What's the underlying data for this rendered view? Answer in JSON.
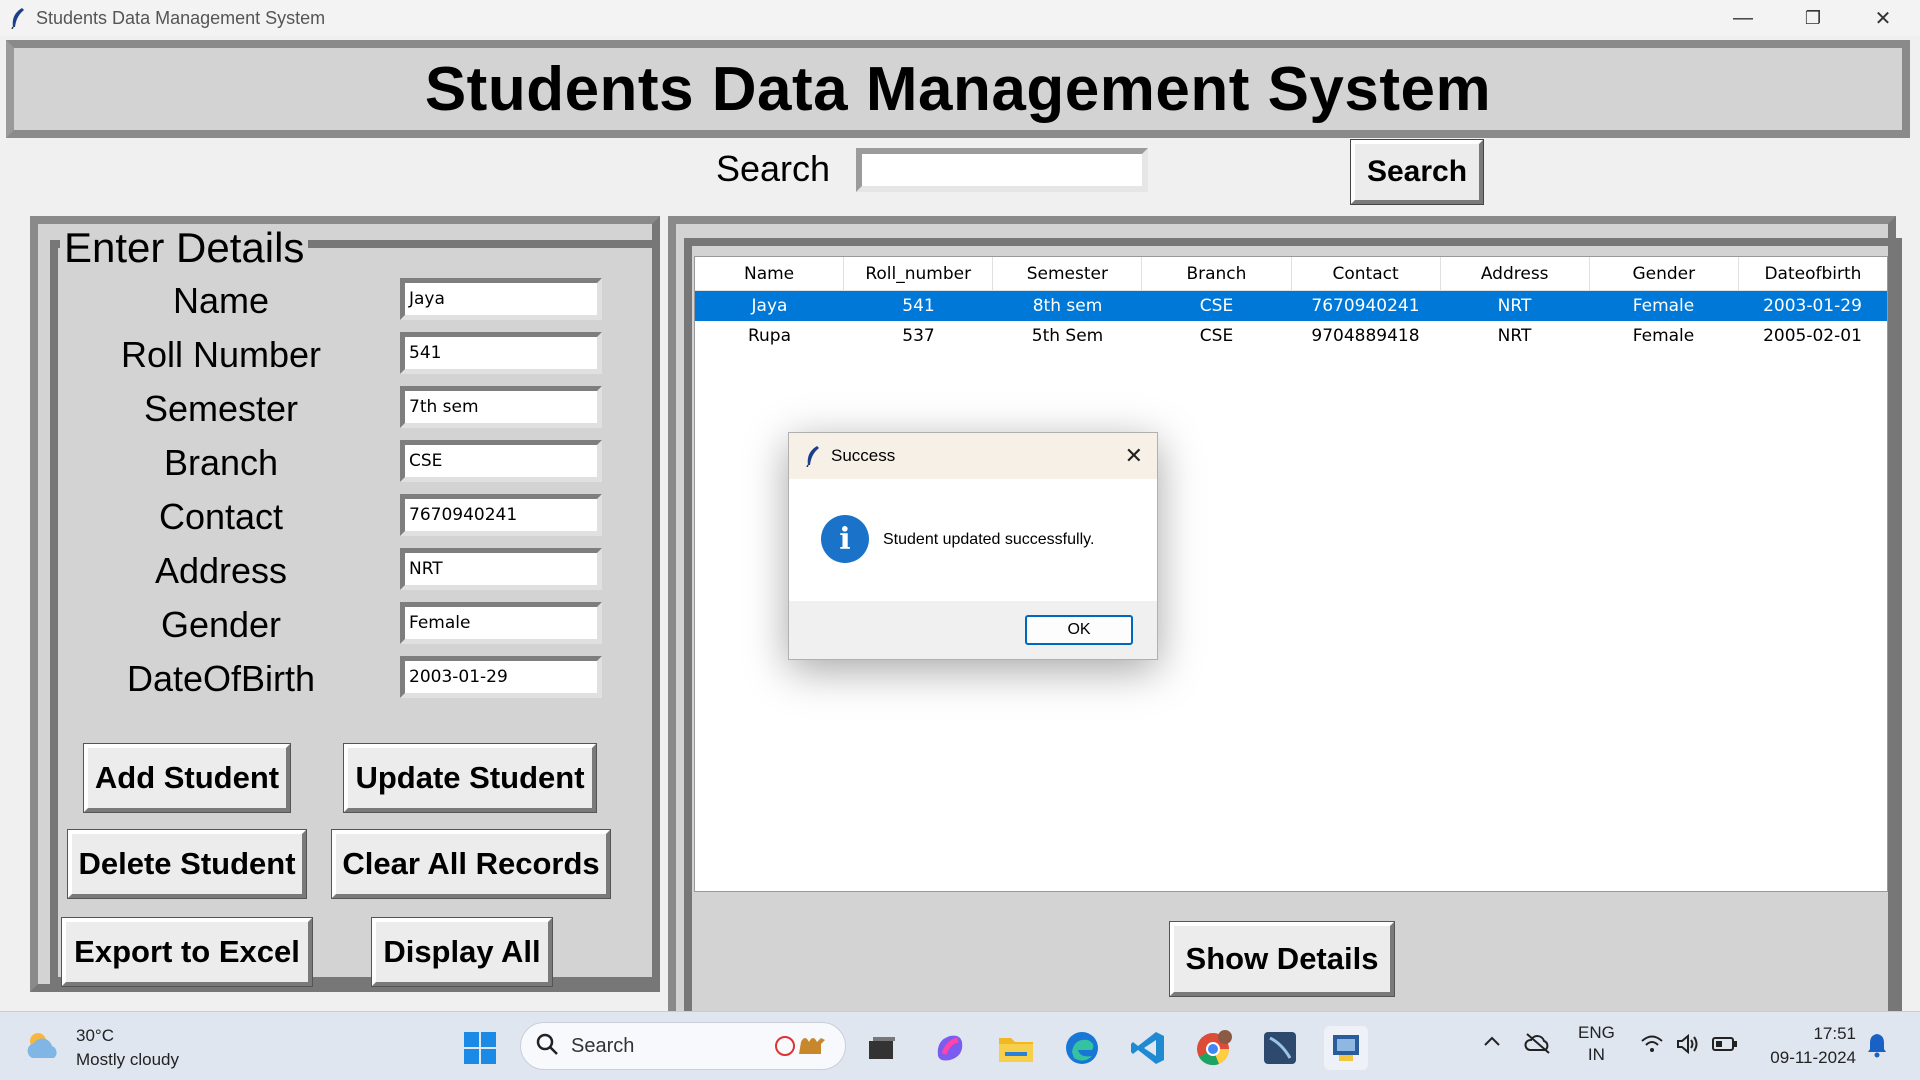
{
  "window": {
    "title": "Students Data Management System",
    "min": "—",
    "restore": "❐",
    "close": "✕"
  },
  "header": {
    "title": "Students Data Management System"
  },
  "search": {
    "label": "Search",
    "value": "",
    "button": "Search"
  },
  "form": {
    "legend": "Enter Details",
    "fields": [
      {
        "label": "Name",
        "value": "Jaya"
      },
      {
        "label": "Roll Number",
        "value": "541"
      },
      {
        "label": "Semester",
        "value": "7th sem"
      },
      {
        "label": "Branch",
        "value": "CSE"
      },
      {
        "label": "Contact",
        "value": "7670940241"
      },
      {
        "label": "Address",
        "value": "NRT"
      },
      {
        "label": "Gender",
        "value": "Female"
      },
      {
        "label": "DateOfBirth",
        "value": "2003-01-29"
      }
    ],
    "buttons": {
      "add": "Add Student",
      "update": "Update Student",
      "delete": "Delete Student",
      "clear": "Clear All Records",
      "export": "Export to Excel",
      "display": "Display All"
    }
  },
  "table": {
    "columns": [
      "Name",
      "Roll_number",
      "Semester",
      "Branch",
      "Contact",
      "Address",
      "Gender",
      "Dateofbirth"
    ],
    "rows": [
      [
        "Jaya",
        "541",
        "8th sem",
        "CSE",
        "7670940241",
        "NRT",
        "Female",
        "2003-01-29"
      ],
      [
        "Rupa",
        "537",
        "5th Sem",
        "CSE",
        "9704889418",
        "NRT",
        "Female",
        "2005-02-01"
      ]
    ],
    "selected_row": 0,
    "show_button": "Show Details"
  },
  "dialog": {
    "title": "Success",
    "message": "Student updated successfully.",
    "ok": "OK",
    "close": "✕"
  },
  "taskbar": {
    "temperature": "30°C",
    "weather": "Mostly cloudy",
    "search_placeholder": "Search",
    "lang": "ENG",
    "region": "IN",
    "time": "17:51",
    "date": "09-11-2024",
    "accent": "#0078d7"
  }
}
